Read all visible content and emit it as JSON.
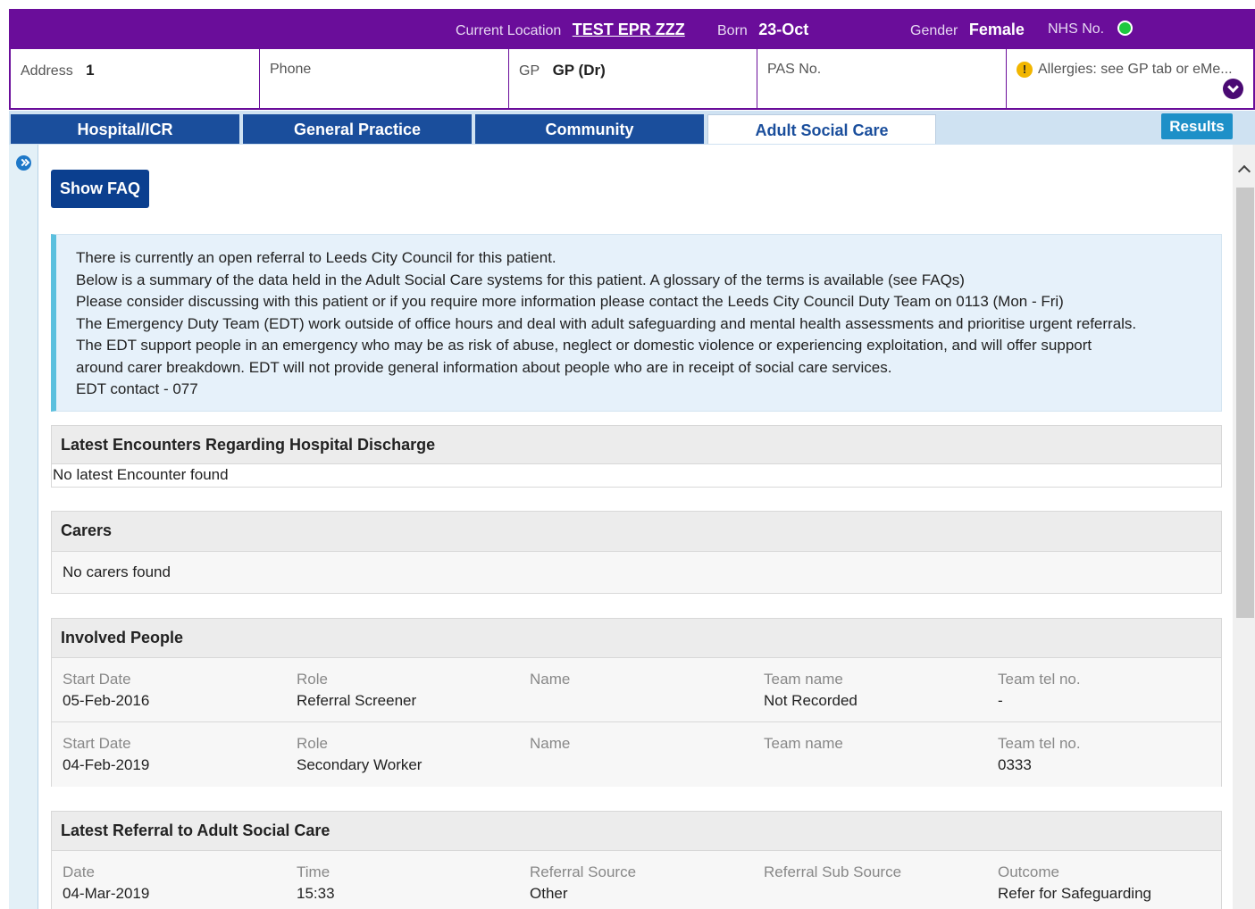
{
  "banner": {
    "current_location_label": "Current Location",
    "current_location": "TEST EPR ZZZ",
    "born_label": "Born",
    "born": "23-Oct",
    "gender_label": "Gender",
    "gender": "Female",
    "nhs_label": "NHS No.",
    "nhs_status_color": "#1ec83f"
  },
  "info": {
    "address_label": "Address",
    "address": "1",
    "phone_label": "Phone",
    "gp_label": "GP",
    "gp": "GP (Dr)",
    "pas_label": "PAS No.",
    "allergies": "Allergies: see GP tab or eMe..."
  },
  "tabs": [
    {
      "label": "Hospital/ICR",
      "active": false
    },
    {
      "label": "General Practice",
      "active": false
    },
    {
      "label": "Community",
      "active": false
    },
    {
      "label": "Adult Social Care",
      "active": true
    }
  ],
  "results_label": "Results",
  "faq_label": "Show FAQ",
  "notice": [
    "There is currently an open referral to Leeds City Council for this patient.",
    "Below is a summary of the data held in the Adult Social Care systems for this patient. A glossary of the terms is available (see FAQs)",
    "Please consider discussing with this patient or if you require more information please contact the Leeds City Council Duty Team on 0113  (Mon - Fri)",
    "The Emergency Duty Team (EDT) work outside of office hours and deal with adult safeguarding and mental health assessments and prioritise urgent referrals.",
    "The EDT support people in an emergency who may be as risk of abuse, neglect or domestic violence or experiencing exploitation, and will offer support",
    "around carer breakdown. EDT will not provide general information about people who are in receipt of social care services.",
    "EDT contact - 077"
  ],
  "encounters": {
    "title": "Latest Encounters Regarding Hospital Discharge",
    "empty": "No latest Encounter found"
  },
  "carers": {
    "title": "Carers",
    "empty": "No carers found"
  },
  "involved": {
    "title": "Involved People",
    "headers": [
      "Start Date",
      "Role",
      "Name",
      "Team name",
      "Team tel no."
    ],
    "rows": [
      [
        "05-Feb-2016",
        "Referral Screener",
        "",
        "Not Recorded",
        "-"
      ],
      [
        "04-Feb-2019",
        "Secondary Worker",
        "",
        "",
        "0333"
      ]
    ]
  },
  "referral": {
    "title": "Latest Referral to Adult Social Care",
    "headers": [
      "Date",
      "Time",
      "Referral Source",
      "Referral Sub Source",
      "Outcome"
    ],
    "rows": [
      [
        "04-Mar-2019",
        "15:33",
        "Other",
        "",
        "Refer for Safeguarding"
      ]
    ]
  },
  "colors": {
    "banner_purple": "#6a0d9a",
    "tab_blue": "#1a4e9c",
    "faq_blue": "#0b3f8f",
    "results_blue": "#1e90c8",
    "notice_accent": "#5bc0de"
  }
}
